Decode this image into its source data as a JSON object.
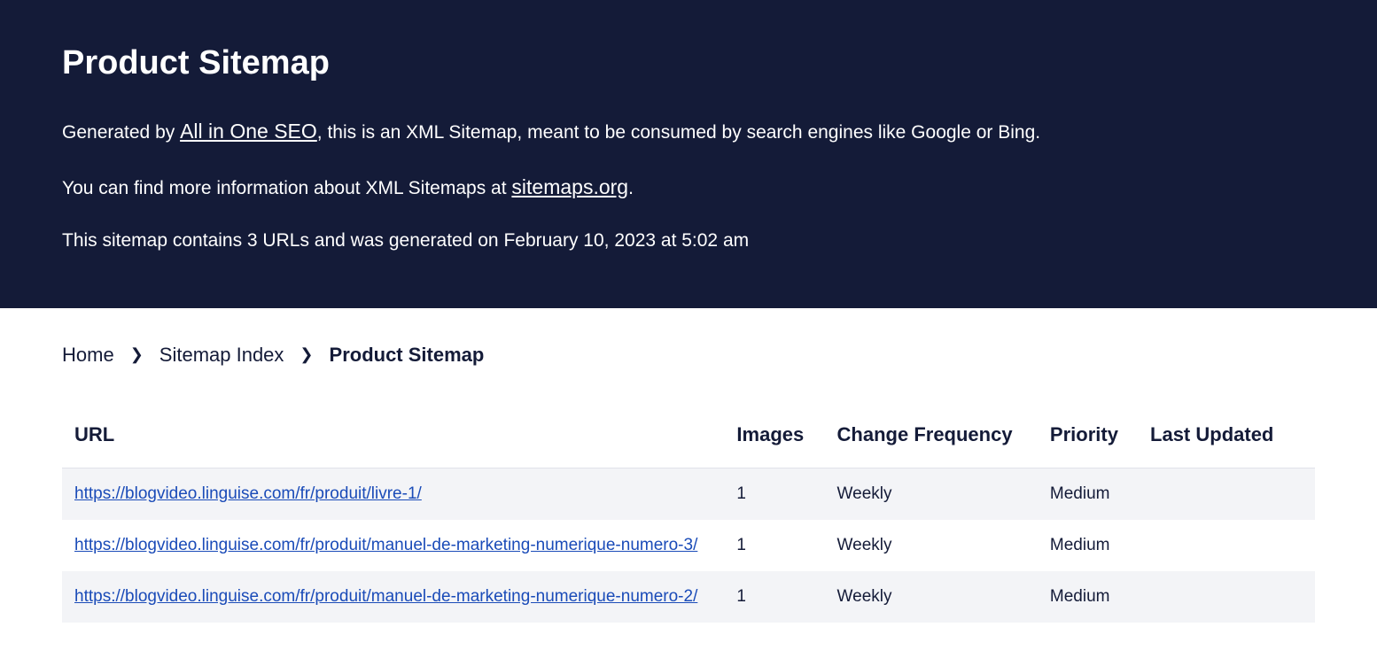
{
  "header": {
    "title": "Product Sitemap",
    "line1_prefix": "Generated by ",
    "line1_link": "All in One SEO",
    "line1_suffix": ", this is an XML Sitemap, meant to be consumed by search engines like Google or Bing.",
    "line2_prefix": "You can find more information about XML Sitemaps at ",
    "line2_link": "sitemaps.org",
    "line2_suffix": ".",
    "line3": "This sitemap contains 3 URLs and was generated on February 10, 2023 at 5:02 am"
  },
  "breadcrumb": {
    "home": "Home",
    "index": "Sitemap Index",
    "current": "Product Sitemap"
  },
  "table": {
    "headers": {
      "url": "URL",
      "images": "Images",
      "freq": "Change Frequency",
      "priority": "Priority",
      "updated": "Last Updated"
    },
    "rows": [
      {
        "url": "https://blogvideo.linguise.com/fr/produit/livre-1/",
        "images": "1",
        "freq": "Weekly",
        "priority": "Medium",
        "updated": ""
      },
      {
        "url": "https://blogvideo.linguise.com/fr/produit/manuel-de-marketing-numerique-numero-3/",
        "images": "1",
        "freq": "Weekly",
        "priority": "Medium",
        "updated": ""
      },
      {
        "url": "https://blogvideo.linguise.com/fr/produit/manuel-de-marketing-numerique-numero-2/",
        "images": "1",
        "freq": "Weekly",
        "priority": "Medium",
        "updated": ""
      }
    ]
  }
}
